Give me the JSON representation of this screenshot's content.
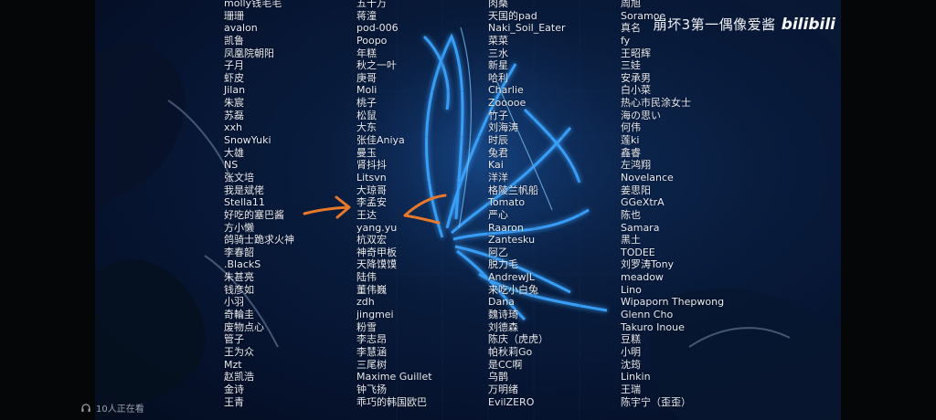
{
  "credits": {
    "col1": [
      "molly钱毛毛",
      "珊珊",
      "avalon",
      "凯鲁",
      "凤凰院朝阳",
      "子月",
      "虾皮",
      "Jilan",
      "朱宸",
      "苏磊",
      "xxh",
      "SnowYuki",
      "大雄",
      "NS",
      "张文培",
      "我是斌佬",
      "Stella11",
      "好吃的塞巴酱",
      "方小懒",
      "鸽骑士跪求火神",
      "李春韶",
      ".BlackS",
      "朱甚亮",
      "钱彦如",
      "小羽",
      "奇輪圭",
      "废物点心",
      "管子",
      "王为众",
      "Mzt",
      "赵凯浩",
      "金诗",
      "王青"
    ],
    "col2": [
      "五十万",
      "蒋潼",
      "pod-006",
      "Poopo",
      "年糕",
      "秋之一叶",
      "庚哥",
      "Moli",
      "桃子",
      "松鼠",
      "大东",
      "张佳Aniya",
      "曼玉",
      "肾抖抖",
      "Litsvn",
      "大琼哥",
      "李孟安",
      "王达",
      "yang.yu",
      "杭双宏",
      "神奇甲板",
      "天降馍馍",
      "陆伟",
      "董伟巍",
      "zdh",
      "jingmei",
      "粉雪",
      "李志昂",
      "李慧涵",
      "三尾树",
      "Maxime Guillet",
      "钟飞扬",
      "乖巧的韩国欧巴"
    ],
    "col3": [
      "肉桑",
      "天国的pad",
      "Naki_Soil_Eater",
      "菜菜",
      "三水",
      "新星",
      "哈利",
      "Charlie",
      "Zooooe",
      "竹子",
      "刘海涛",
      "时辰",
      "兔君",
      "Kai",
      "洋洋",
      "格陵兰帆船",
      "Tomato",
      "严心",
      "Raaron",
      "Zantesku",
      "阿乙",
      "脱力毛",
      "AndrewJL",
      "来吃小白兔",
      "Dana",
      "魏诗琦",
      "刘德森",
      "陈庆（虎虎）",
      "帕秋莉Go",
      "是CC啊",
      "乌鹊",
      "万明绪",
      "EvilZERO"
    ],
    "col4": [
      "周旭",
      "Soramoe",
      "真名",
      "fy",
      "王昭辉",
      "三娃",
      "安承男",
      "白小菜",
      "热心市民涂女士",
      "海の思い",
      "何伟",
      "莲ki",
      "鑫睿",
      "左鸿翔",
      "Novelance",
      "姜思阳",
      "GGeXtrA",
      "陈也",
      "Samara",
      "黑土",
      "TODEE",
      "刘罗涛Tony",
      "meadow",
      "Lino",
      "Wipaporn Thepwong",
      "Glenn Cho",
      "Takuro Inoue",
      "豆糕",
      "小明",
      "沈筠",
      "Linkin",
      "王瑞",
      "陈宇宁（歪歪）"
    ]
  },
  "watermark": {
    "text": "崩坏3第一偶像爱酱",
    "logo": "bilibili"
  },
  "viewers": {
    "count_text": "10人正在看",
    "icon": "headset-icon"
  },
  "colors": {
    "annotation": "#e8782a",
    "glow": "#3aa4ff",
    "text": "#e6eaf2"
  }
}
